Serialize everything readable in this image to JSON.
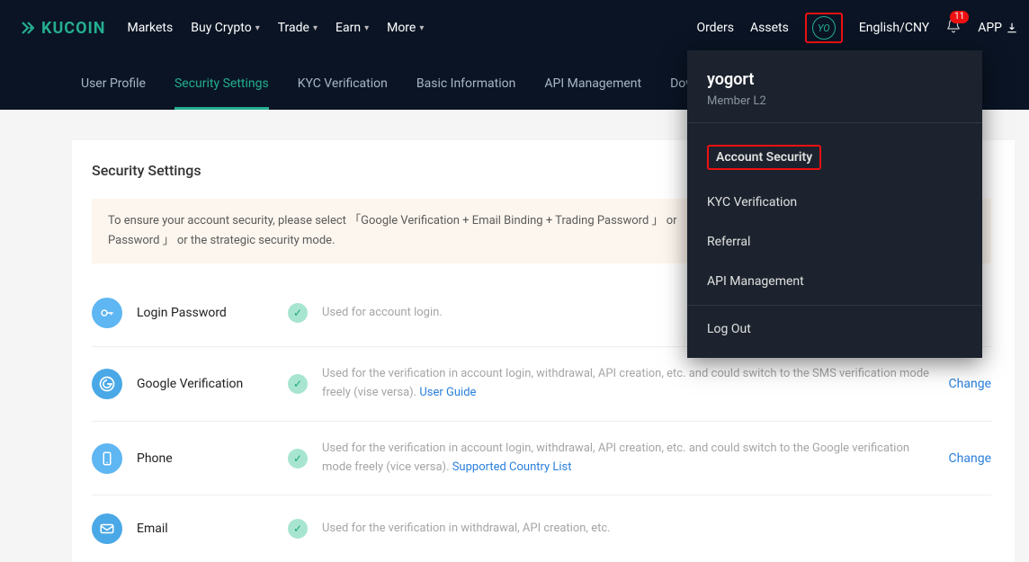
{
  "brand": "KUCOIN",
  "nav": {
    "markets": "Markets",
    "buy": "Buy Crypto",
    "trade": "Trade",
    "earn": "Earn",
    "more": "More"
  },
  "header": {
    "orders": "Orders",
    "assets": "Assets",
    "avatar_initials": "YO",
    "lang": "English/CNY",
    "badge_count": "11",
    "app": "APP"
  },
  "tabs": {
    "profile": "User Profile",
    "security": "Security Settings",
    "kyc": "KYC Verification",
    "basic": "Basic Information",
    "api": "API Management",
    "download": "Download"
  },
  "page_title": "Security Settings",
  "notice": "To ensure your account security, please select  「Google Verification + Email Binding + Trading Password 」 or  「Phone Verification + Email Binding + Trading Password 」 or the strategic security mode.",
  "rows": {
    "login": {
      "label": "Login Password",
      "desc": "Used for account login."
    },
    "google": {
      "label": "Google Verification",
      "desc_a": "Used for the verification in account login, withdrawal, API creation, etc. and could switch to the SMS verification mode freely (vise versa). ",
      "link": "User Guide",
      "action": "Change"
    },
    "phone": {
      "label": "Phone",
      "desc_a": "Used for the verification in account login, withdrawal, API creation, etc. and could switch to the Google verification mode freely (vice versa). ",
      "link": "Supported Country List",
      "action": "Change"
    },
    "email": {
      "label": "Email",
      "desc": "Used for the verification in withdrawal, API creation, etc."
    }
  },
  "popover": {
    "user": "yogort",
    "tier": "Member L2",
    "items": {
      "security": "Account Security",
      "kyc": "KYC Verification",
      "referral": "Referral",
      "api": "API Management",
      "logout": "Log Out"
    }
  }
}
